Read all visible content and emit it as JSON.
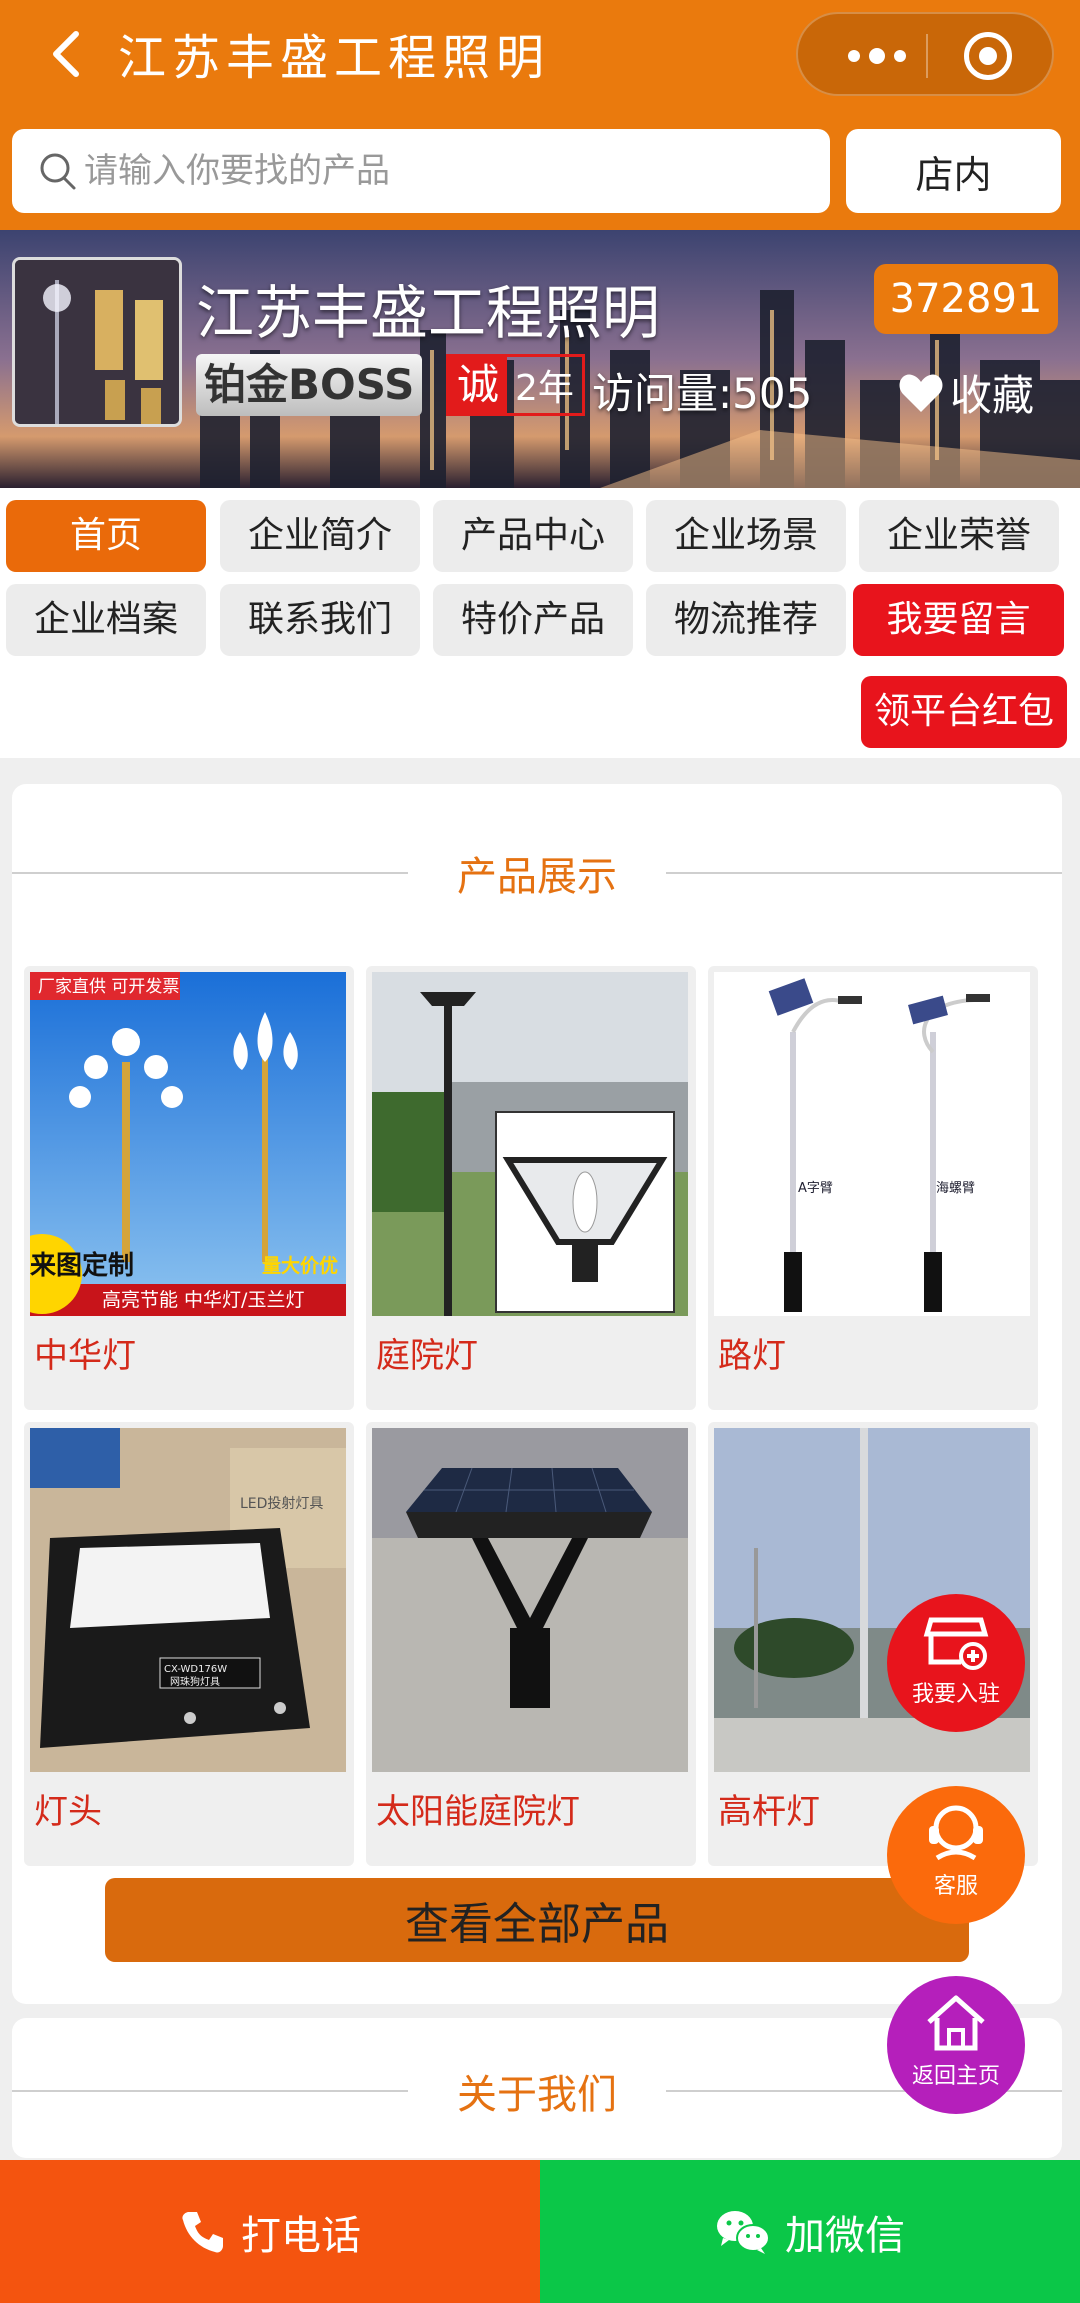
{
  "header": {
    "title": "江苏丰盛工程照明",
    "back_icon": "chevron-left-icon",
    "more_icon": "more-dots-icon",
    "close_icon": "target-circle-icon",
    "accent": "#ea7a0d"
  },
  "search": {
    "placeholder": "请输入你要找的产品",
    "store_button": "店内"
  },
  "shop": {
    "name": "江苏丰盛工程照明",
    "id": "372891",
    "level": "铂金BOSS",
    "cheng": "诚",
    "years": "2年",
    "visits": "访问量:505",
    "favorite": "收藏"
  },
  "nav": {
    "items": [
      "首页",
      "企业简介",
      "产品中心",
      "企业场景",
      "企业荣誉",
      "企业档案",
      "联系我们",
      "特价产品",
      "物流推荐",
      "我要留言"
    ],
    "redpacket": "领平台红包",
    "active_color": "#ea6a0a",
    "red_color": "#e8141c"
  },
  "products_section": {
    "title": "产品展示",
    "items": [
      {
        "name": "中华灯",
        "tag": "厂家直供 可开发票",
        "badge_left": "来图定制",
        "badge_right": "量大价优",
        "banner": "高亮节能 中华灯/玉兰灯"
      },
      {
        "name": "庭院灯"
      },
      {
        "name": "路灯",
        "text1": "A字臂",
        "text2": "海螺臂"
      },
      {
        "name": "灯头",
        "box_label": "LED投射灯具",
        "plate_label": "CX-WD176W",
        "plate_sub": "网珠狗灯具"
      },
      {
        "name": "太阳能庭院灯"
      },
      {
        "name": "高杆灯"
      }
    ],
    "view_all": "查看全部产品"
  },
  "about_section": {
    "title": "关于我们"
  },
  "floating": {
    "join": "我要入驻",
    "service": "客服",
    "home": "返回主页"
  },
  "bottom": {
    "call": "打电话",
    "wechat": "加微信",
    "call_color": "#f4540f",
    "wechat_color": "#0bc748"
  }
}
